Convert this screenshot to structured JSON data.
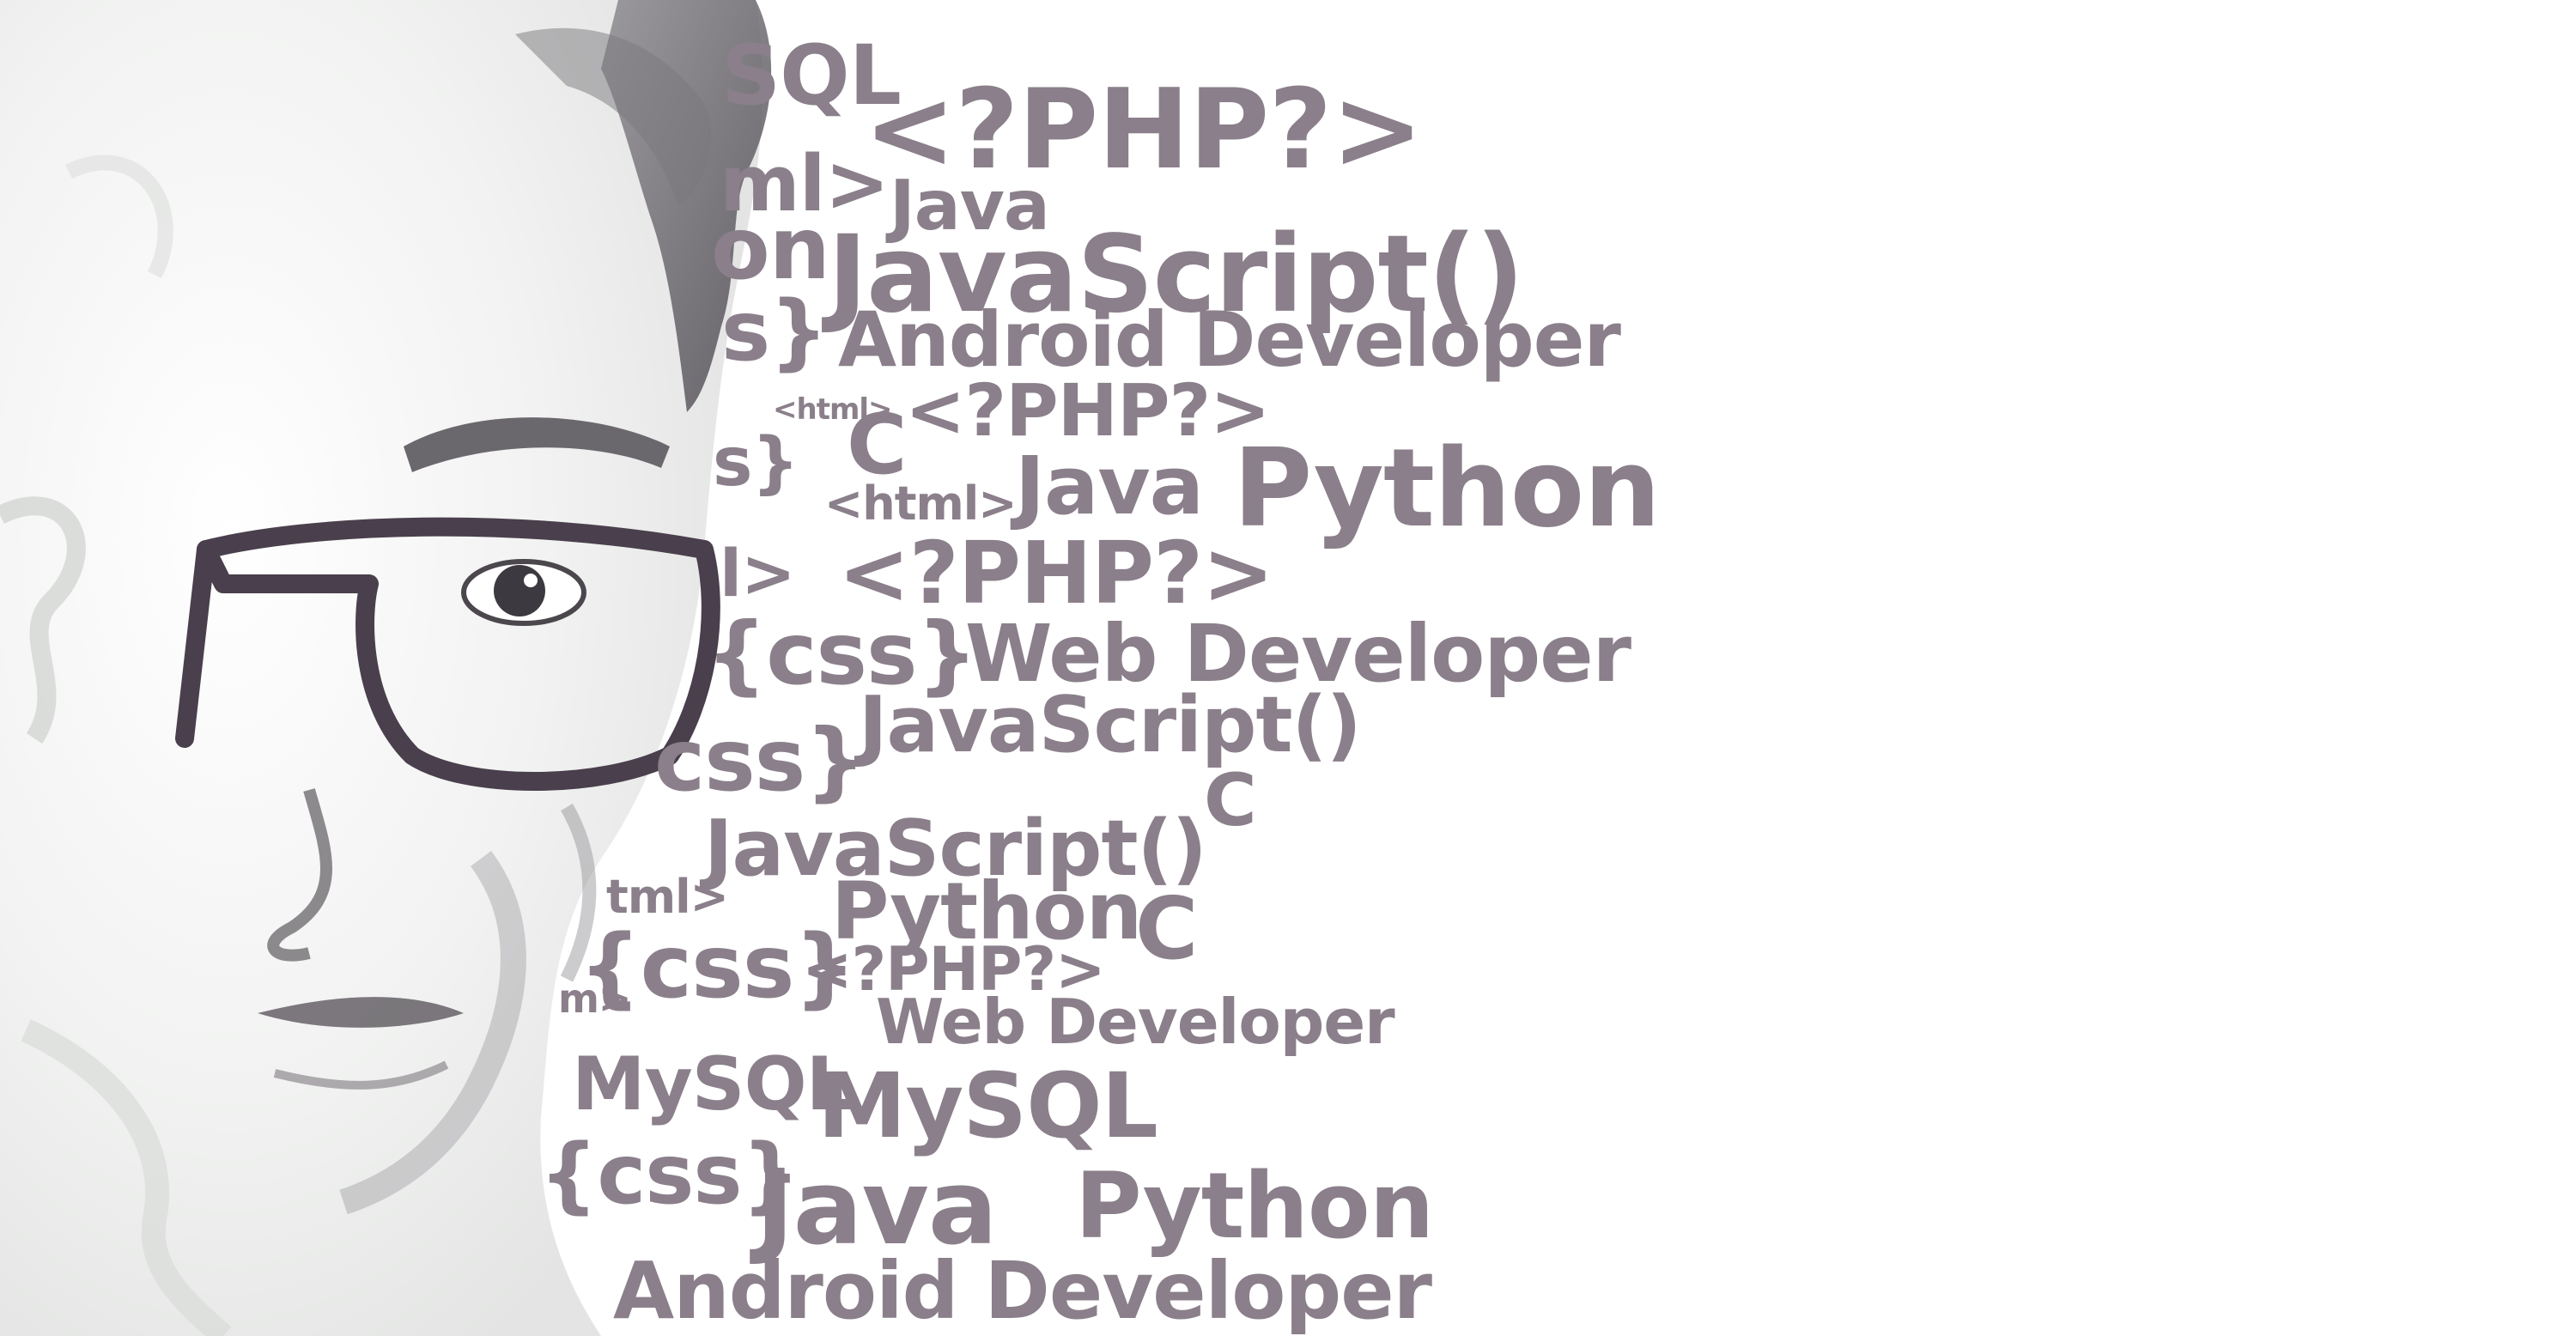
{
  "words": [
    "SQL",
    "<?PHP?>",
    "ml>",
    "Java",
    "on",
    "JavaScript()",
    "s}",
    "Android Developer",
    "<html>",
    "C",
    "<?PHP?>",
    "s}",
    "<html>",
    "Java",
    "Python",
    "l>",
    "<?PHP?>",
    "{css}",
    "Web Developer",
    "JavaScript()",
    "css}",
    "C",
    "JavaScript()",
    "tml>",
    "Python",
    "C",
    "{css}",
    "<?PHP?>",
    "m>",
    "Web Developer",
    "MySQL",
    "MySQL",
    "{css}",
    "Java",
    "Python",
    "Android Developer"
  ],
  "colors": {
    "text": "#8a7f8a",
    "portrait_shade": "#5b585f",
    "background": "#ffffff"
  }
}
